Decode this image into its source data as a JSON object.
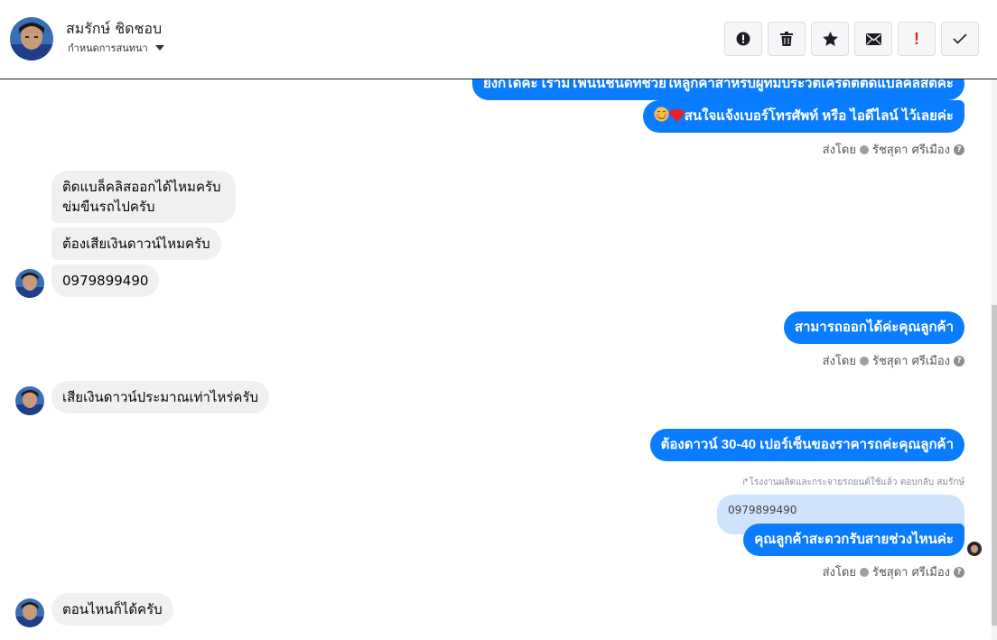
{
  "header": {
    "contact_name": "สมรักษ์ ชิดชอบ",
    "subtitle": "กำหนดการสนทนา",
    "actions": [
      "spam-icon",
      "trash-icon",
      "star-icon",
      "envelope-icon",
      "important-icon",
      "check-icon"
    ],
    "important_label": "!"
  },
  "messages": {
    "out_top_cut": "ยังก็ได้ค่ะ เรามีโฟนนี่ชนิดที่ช่วยให้ลูกค้าสำหรับผู้ที่มีประวัติเครดิตติดแบล็คลิสต์ค่ะ",
    "out_phone_line": "สนใจแจ้งเบอร์โทรศัพท์ หรือ ไอดีไลน์  ไว้เลยค่ะ",
    "sent_by_label": "ส่งโดย",
    "sender_name": "รัชสุดา ศรีเมือง",
    "in_blacklist_1": "ติดแบล็คลิสออกได้ไหมครับ",
    "in_blacklist_2": "ข่มขืนรถไปครับ",
    "in_downpay": "ต้องเสียเงินดาวน์ไหมครับ",
    "in_phone": "0979899490",
    "out_can": "สามารถออกได้ค่ะคุณลูกค้า",
    "in_howmuch": "เสียเงินดาวน์ประมาณเท่าไหร่ครับ",
    "out_percent": "ต้องดาวน์ 30-40 เปอร์เซ็นของราคารถค่ะคุณลูกค้า",
    "reply_note": "โรงงานผลิตและกระจายรถยนต์ใช้แล้ว ตอบกลับ สมรักษ์",
    "quoted_phone": "0979899490",
    "out_time": "คุณลูกค้าสะดวกรับสายช่วงไหนค่ะ",
    "in_anytime": "ตอนไหนก็ได้ครับ"
  },
  "colors": {
    "outgoing": "#0a7cff",
    "incoming": "#f0f0f0",
    "quote": "#cfe3fd"
  }
}
